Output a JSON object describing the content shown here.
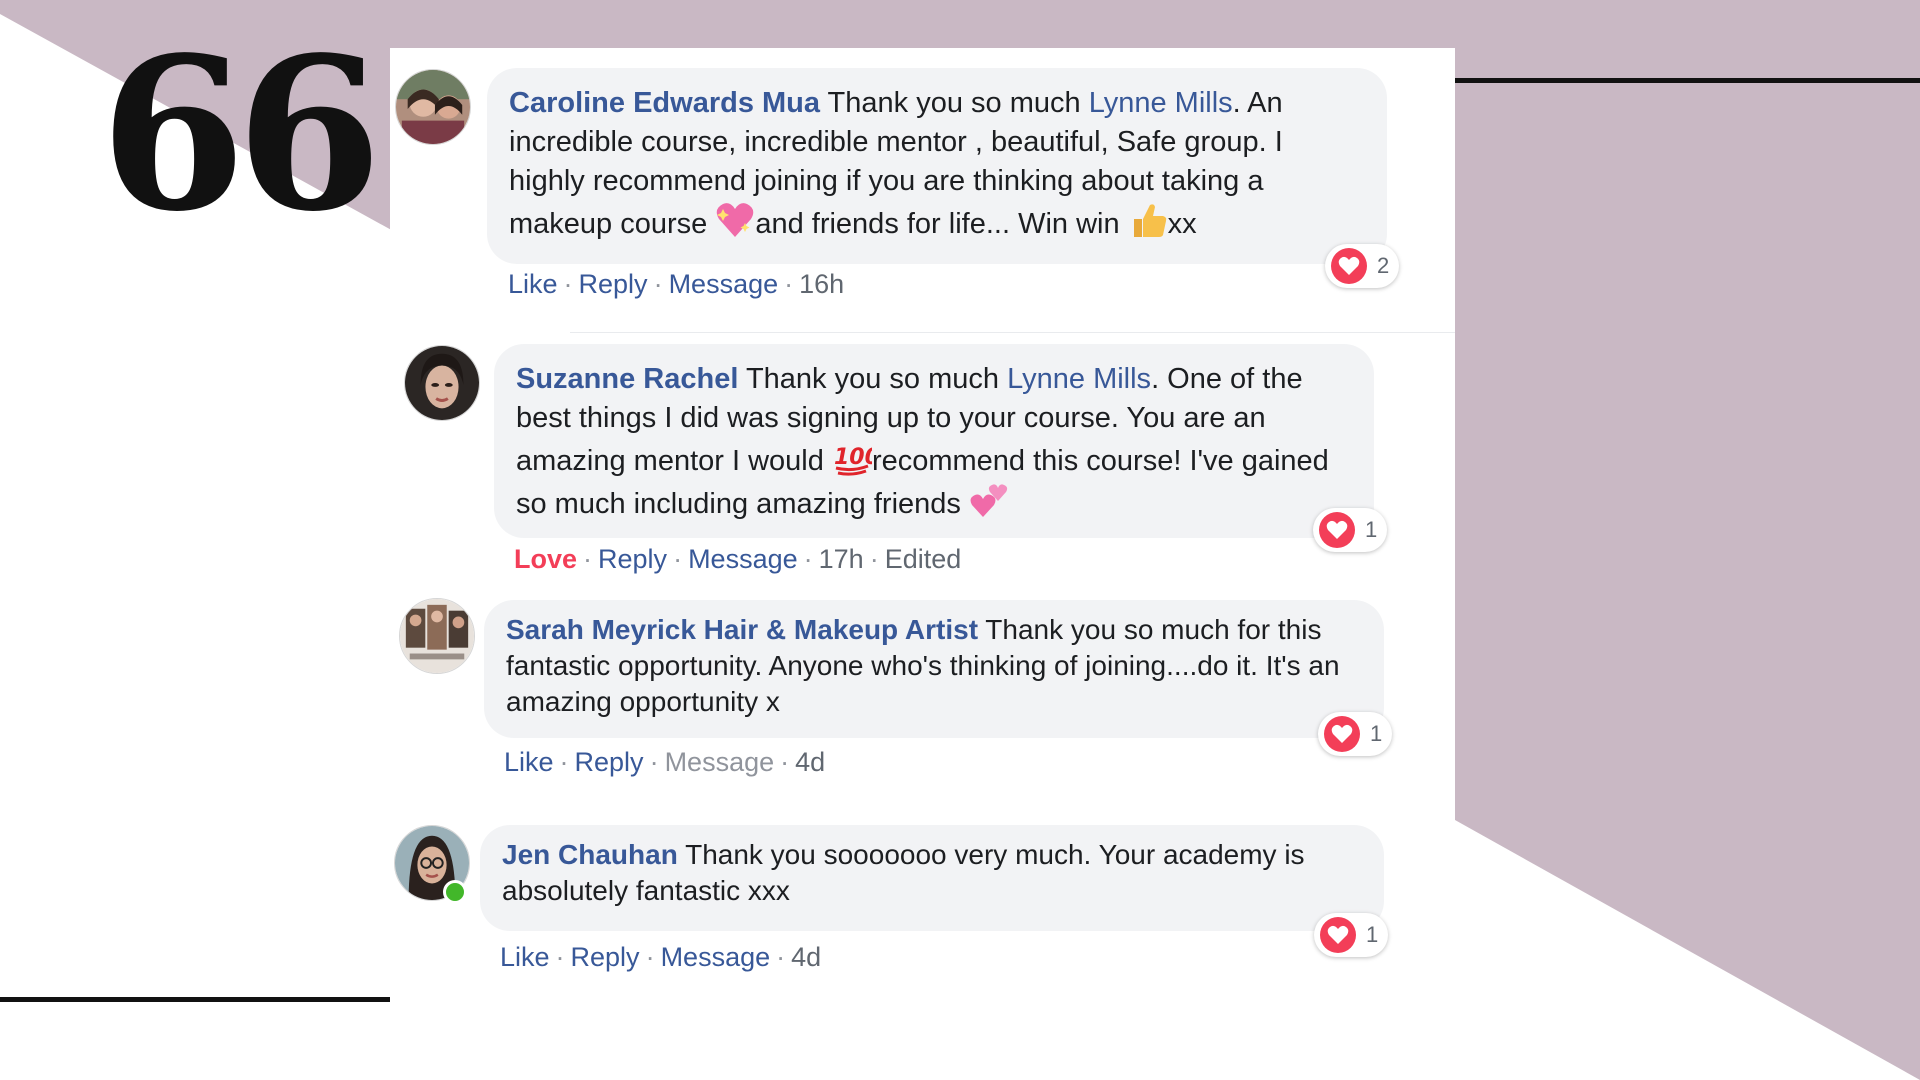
{
  "theme": {
    "mauve": "#c9b8c4",
    "ink": "#111111",
    "link_blue": "#385898",
    "love_red": "#f33e58",
    "bubble_gray": "#f2f3f5"
  },
  "decor": {
    "quote_mark": "66"
  },
  "comments": [
    {
      "author": "Caroline Edwards Mua",
      "text1": " Thank you so much ",
      "mention": "Lynne Mills",
      "text2": ". An incredible course, incredible mentor , beautiful, Safe group. I highly recommend joining if you are thinking about taking a makeup course ",
      "emoji1": "sparkling-heart",
      "text3": "and friends for life... Win win ",
      "emoji2": "thumbs-up",
      "text4": "xx",
      "action1": "Like",
      "action2": "Reply",
      "action3": "Message",
      "time": "16h",
      "reaction_count": "2"
    },
    {
      "author": "Suzanne Rachel",
      "text1": " Thank you so much ",
      "mention": "Lynne Mills",
      "text2": ". One of the best things I did was signing up to your course. You are an amazing mentor I would ",
      "emoji1": "hundred-points",
      "text3": "recommend this course! I've gained so much including amazing friends ",
      "emoji2": "two-hearts",
      "action1": "Love",
      "action2": "Reply",
      "action3": "Message",
      "time": "17h",
      "edited": "Edited",
      "reaction_count": "1"
    },
    {
      "author": "Sarah Meyrick Hair & Makeup Artist",
      "text1": " Thank you so much for this fantastic opportunity. Anyone who's thinking of joining....do it. It's an amazing opportunity x",
      "action1": "Like",
      "action2": "Reply",
      "action3": "Message",
      "time": "4d",
      "reaction_count": "1"
    },
    {
      "author": "Jen Chauhan",
      "text1": " Thank you sooooooo very much. Your academy is absolutely fantastic xxx",
      "action1": "Like",
      "action2": "Reply",
      "action3": "Message",
      "time": "4d",
      "reaction_count": "1",
      "online": true
    }
  ]
}
